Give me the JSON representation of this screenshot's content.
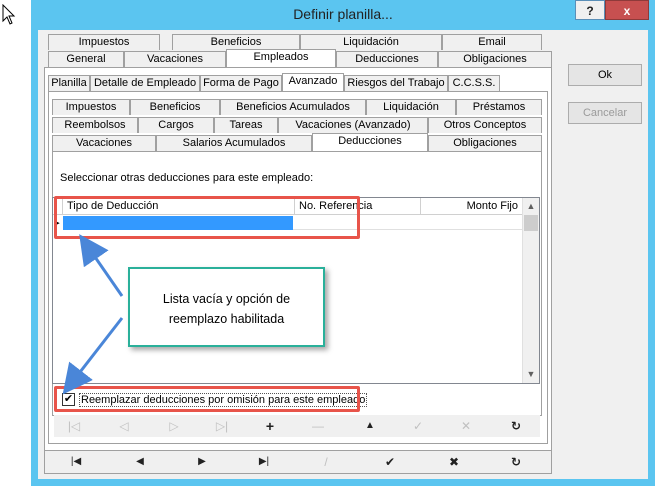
{
  "window": {
    "title": "Definir planilla...",
    "help_label": "?",
    "close_label": "x"
  },
  "tabs_top": {
    "row1": [
      "Impuestos",
      "Beneficios",
      "Liquidación",
      "Email"
    ],
    "row2": [
      "General",
      "Vacaciones",
      "Empleados",
      "Deducciones",
      "Obligaciones"
    ],
    "selected": "Empleados"
  },
  "tabs_second": {
    "items": [
      "Planilla",
      "Detalle de Empleado",
      "Forma de Pago",
      "Avanzado",
      "Riesgos del Trabajo",
      "C.C.S.S."
    ],
    "selected": "Avanzado"
  },
  "tabs_third": {
    "row1": [
      "Impuestos",
      "Beneficios",
      "Beneficios Acumulados",
      "Liquidación",
      "Préstamos"
    ],
    "row2": [
      "Reembolsos",
      "Cargos",
      "Tareas",
      "Vacaciones (Avanzado)",
      "Otros Conceptos"
    ],
    "row3": [
      "Vacaciones",
      "Salarios Acumulados",
      "Deducciones",
      "Obligaciones"
    ],
    "selected": "Deducciones"
  },
  "content": {
    "instruction": "Seleccionar otras deducciones para este empleado:",
    "grid_columns": [
      "Tipo de Deducción",
      "No. Referencia",
      "Monto Fijo"
    ],
    "replace_checkbox_label": "Reemplazar deducciones por omisión para este empleado",
    "replace_checked": true
  },
  "callout": {
    "line1": "Lista vacía y opción de",
    "line2": "reemplazo habilitada"
  },
  "side_buttons": {
    "ok": "Ok",
    "cancel": "Cancelar"
  },
  "colors": {
    "titlebar": "#5bc5f0",
    "highlight_frame": "#e8544a",
    "callout_border": "#2ab09a",
    "selection": "#3399ff",
    "arrow": "#4a86d8"
  }
}
